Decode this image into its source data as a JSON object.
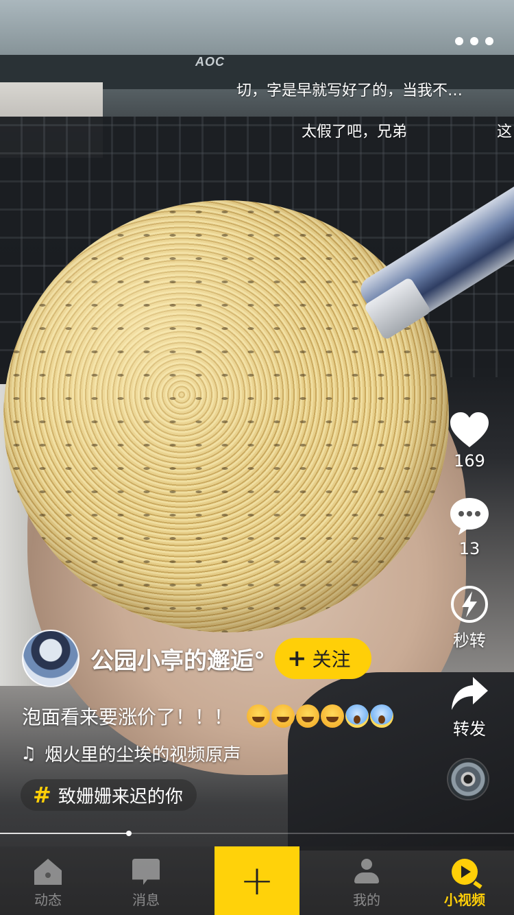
{
  "danmu": [
    "切，字是早就写好了的，当我不…",
    "太假了吧，兄弟",
    "这"
  ],
  "actions": {
    "like_count": "169",
    "comment_count": "13",
    "quick_share_label": "秒转",
    "forward_label": "转发"
  },
  "author": {
    "name": "公园小亭的邂逅°",
    "follow_label": "关注"
  },
  "post": {
    "caption": "泡面看来要涨价了！！！",
    "emojis": [
      "grinning-face",
      "tears-of-joy",
      "tears-of-joy",
      "tears-of-joy",
      "screaming-face",
      "screaming-face"
    ],
    "music": "烟火里的尘埃的视频原声",
    "topic": "致姗姗来迟的你"
  },
  "playback": {
    "progress": 0.25
  },
  "tabbar": {
    "tabs": [
      {
        "label": "动态",
        "icon": "home-icon",
        "active": false
      },
      {
        "label": "消息",
        "icon": "message-icon",
        "active": false
      },
      {
        "label": "我的",
        "icon": "user-icon",
        "active": false
      },
      {
        "label": "小视频",
        "icon": "video-play-icon",
        "active": true
      }
    ],
    "publish_icon": "plus-icon"
  },
  "colors": {
    "accent": "#ffcf08",
    "text": "#ffffff"
  }
}
